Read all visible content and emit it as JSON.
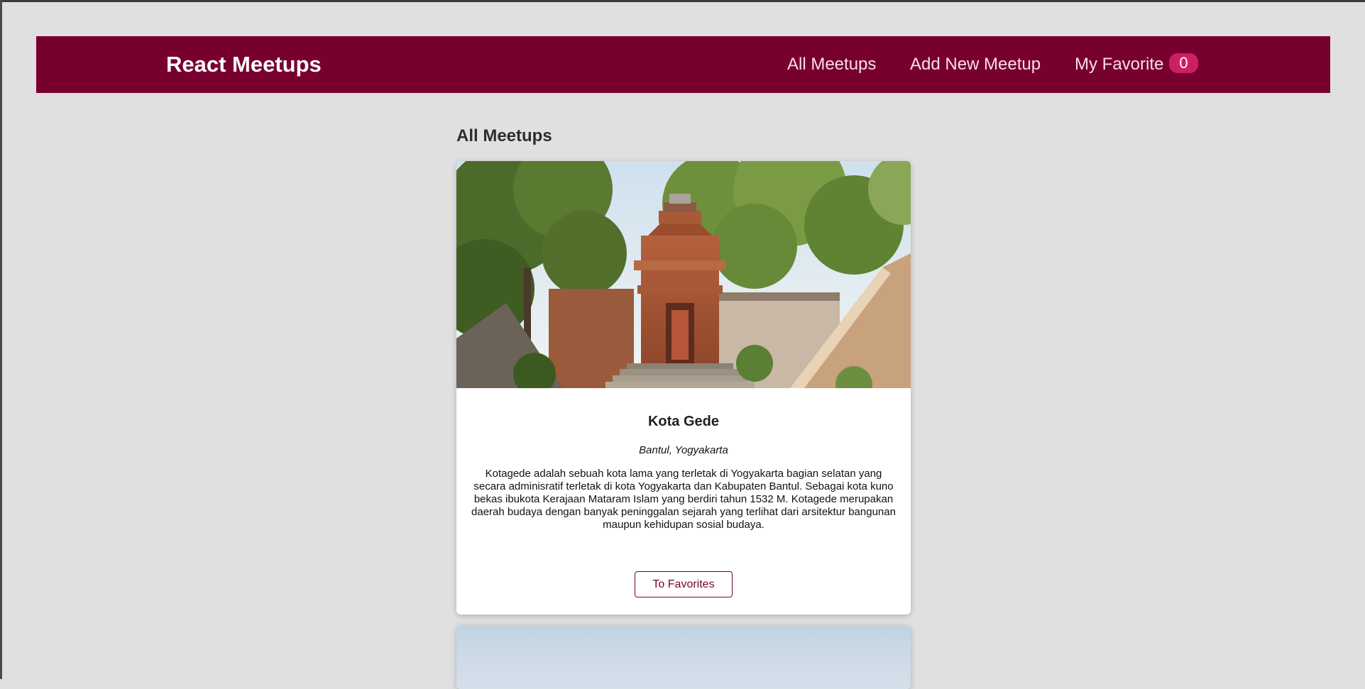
{
  "header": {
    "logo": "React Meetups",
    "nav": {
      "all_meetups": "All Meetups",
      "add_new_meetup": "Add New Meetup",
      "my_favorite": "My Favorite",
      "favorite_count": "0"
    },
    "colors": {
      "background": "#77002e",
      "badge": "#cc2062"
    }
  },
  "main": {
    "title": "All Meetups",
    "meetups": [
      {
        "image_icon": "temple-gate-photo",
        "title": "Kota Gede",
        "address": "Bantul, Yogyakarta",
        "description": "Kotagede adalah sebuah kota lama yang terletak di Yogyakarta bagian selatan yang secara adminisratif terletak di kota Yogyakarta dan Kabupaten Bantul. Sebagai kota kuno bekas ibukota Kerajaan Mataram Islam yang berdiri tahun 1532 M. Kotagede merupakan daerah budaya dengan banyak peninggalan sejarah yang terlihat dari arsitektur bangunan maupun kehidupan sosial budaya.",
        "button_label": "To Favorites"
      },
      {
        "image_icon": "sky-photo"
      }
    ]
  }
}
